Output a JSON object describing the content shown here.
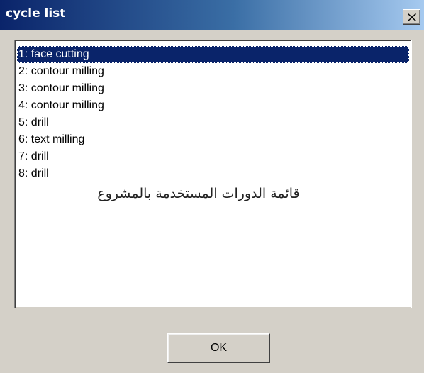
{
  "window": {
    "title": "cycle list",
    "title_gradient": [
      "#0a246a",
      "#a6caf0"
    ],
    "close_icon": "close-icon"
  },
  "list": {
    "items": [
      "1: face cutting",
      "2: contour milling",
      "3: contour milling",
      "4: contour milling",
      "5: drill",
      "6: text milling",
      "7: drill",
      "8: drill"
    ],
    "selected_index": 0,
    "selection_color": "#0a246a"
  },
  "annotation": "قائمة الدورات المستخدمة بالمشروع",
  "buttons": {
    "ok_label": "OK"
  }
}
